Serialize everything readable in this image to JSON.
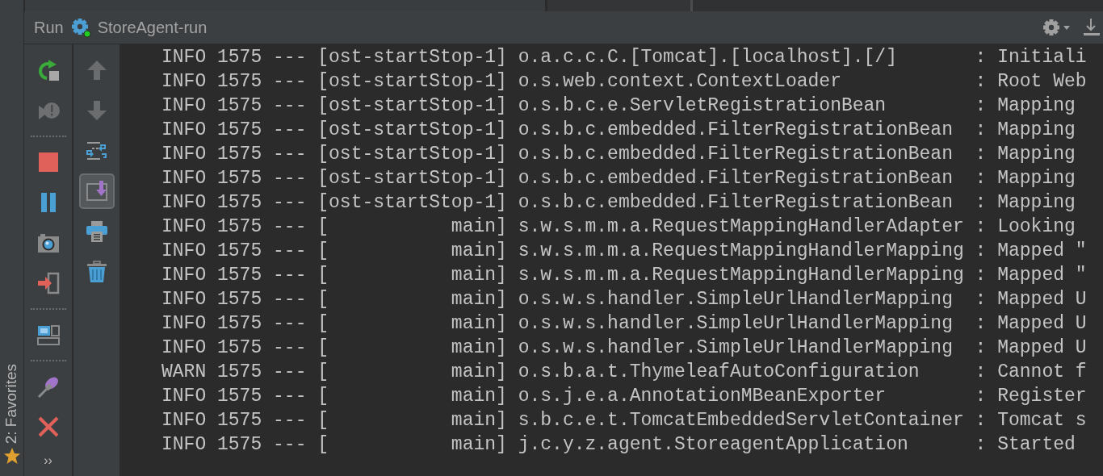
{
  "header": {
    "title": "Run",
    "config": "StoreAgent-run",
    "running": true
  },
  "sidebar": {
    "favorites": "2: Favorites"
  },
  "toolbar_left": [
    {
      "kind": "rerun"
    },
    {
      "kind": "debug"
    },
    {
      "kind": "separator"
    },
    {
      "kind": "stop"
    },
    {
      "kind": "pause"
    },
    {
      "kind": "camera"
    },
    {
      "kind": "exit"
    },
    {
      "kind": "separator"
    },
    {
      "kind": "layout"
    },
    {
      "kind": "separator"
    },
    {
      "kind": "pin"
    },
    {
      "kind": "close"
    },
    {
      "kind": "more",
      "text": "››"
    }
  ],
  "toolbar_right": [
    {
      "kind": "up",
      "selected": false
    },
    {
      "kind": "down",
      "selected": false
    },
    {
      "kind": "wrap",
      "selected": false
    },
    {
      "kind": "scroll-end",
      "selected": true
    },
    {
      "kind": "print",
      "selected": false
    },
    {
      "kind": "trash",
      "selected": false
    }
  ],
  "console": {
    "lines": [
      "INFO 1575 --- [ost-startStop-1] o.a.c.c.C.[Tomcat].[localhost].[/]       : Initiali",
      "INFO 1575 --- [ost-startStop-1] o.s.web.context.ContextLoader            : Root Web",
      "INFO 1575 --- [ost-startStop-1] o.s.b.c.e.ServletRegistrationBean        : Mapping",
      "INFO 1575 --- [ost-startStop-1] o.s.b.c.embedded.FilterRegistrationBean  : Mapping",
      "INFO 1575 --- [ost-startStop-1] o.s.b.c.embedded.FilterRegistrationBean  : Mapping",
      "INFO 1575 --- [ost-startStop-1] o.s.b.c.embedded.FilterRegistrationBean  : Mapping",
      "INFO 1575 --- [ost-startStop-1] o.s.b.c.embedded.FilterRegistrationBean  : Mapping",
      "INFO 1575 --- [           main] s.w.s.m.m.a.RequestMappingHandlerAdapter : Looking",
      "INFO 1575 --- [           main] s.w.s.m.m.a.RequestMappingHandlerMapping : Mapped \"",
      "INFO 1575 --- [           main] s.w.s.m.m.a.RequestMappingHandlerMapping : Mapped \"",
      "INFO 1575 --- [           main] o.s.w.s.handler.SimpleUrlHandlerMapping  : Mapped U",
      "INFO 1575 --- [           main] o.s.w.s.handler.SimpleUrlHandlerMapping  : Mapped U",
      "INFO 1575 --- [           main] o.s.w.s.handler.SimpleUrlHandlerMapping  : Mapped U",
      "WARN 1575 --- [           main] o.s.b.a.t.ThymeleafAutoConfiguration     : Cannot f",
      "INFO 1575 --- [           main] o.s.j.e.a.AnnotationMBeanExporter        : Register",
      "INFO 1575 --- [           main] s.b.c.e.t.TomcatEmbeddedServletContainer : Tomcat s",
      "INFO 1575 --- [           main] j.c.y.z.agent.StoreagentApplication      : Started"
    ]
  }
}
